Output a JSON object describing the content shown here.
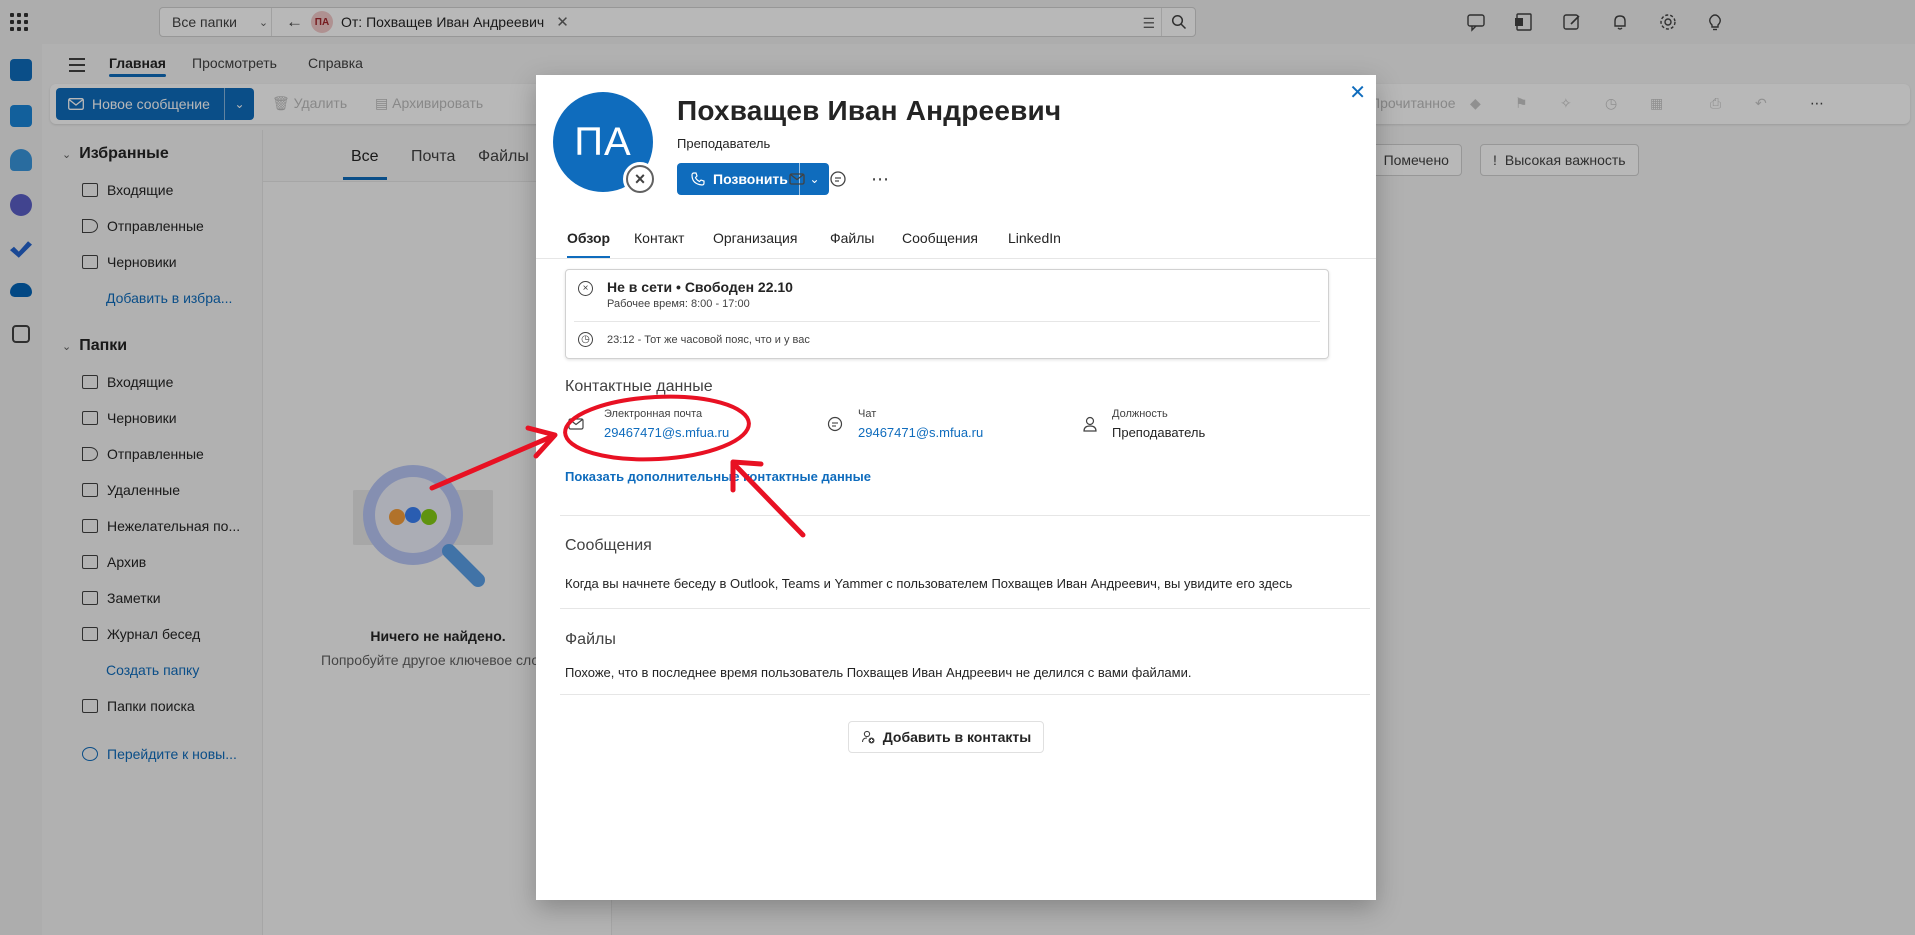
{
  "topbar": {
    "search_scope": "Все папки",
    "search_avatar_initials": "ПА",
    "search_chip": "От: Похващев Иван Андреевич",
    "icons": [
      "waffle-icon",
      "feedback-icon",
      "onenote-icon",
      "my-day-icon",
      "notifications-icon",
      "settings-icon",
      "tips-icon"
    ]
  },
  "ribbon": {
    "tabs": [
      "Главная",
      "Просмотреть",
      "Справка"
    ],
    "active_tab": "Главная",
    "new_message": "Новое сообщение",
    "commands": [
      "Удалить",
      "Архивировать",
      "Прочитанное"
    ]
  },
  "folders": {
    "favorites_header": "Избранные",
    "favorites": [
      "Входящие",
      "Отправленные",
      "Черновики"
    ],
    "add_favorite": "Добавить в избра...",
    "folders_header": "Папки",
    "items": [
      "Входящие",
      "Черновики",
      "Отправленные",
      "Удаленные",
      "Нежелательная по...",
      "Архив",
      "Заметки",
      "Журнал бесед"
    ],
    "create_folder": "Создать папку",
    "search_folders": "Папки поиска",
    "go_to_groups": "Перейдите к новы..."
  },
  "list": {
    "tabs": [
      "Все",
      "Почта",
      "Файлы"
    ],
    "empty_title": "Ничего не найдено.",
    "empty_subtitle": "Попробуйте другое ключевое сло"
  },
  "reading": {
    "flagged": "Помечено",
    "high_importance": "Высокая важность"
  },
  "card": {
    "initials": "ПА",
    "name": "Похващев Иван Андреевич",
    "job_title": "Преподаватель",
    "call_label": "Позвонить",
    "tabs": [
      "Обзор",
      "Контакт",
      "Организация",
      "Файлы",
      "Сообщения",
      "LinkedIn"
    ],
    "active_tab": "Обзор",
    "status": {
      "availability": "Не в сети • Свободен 22.10",
      "work_hours": "Рабочее время: 8:00 - 17:00",
      "local_time": "23:12 - Тот же часовой пояс, что и у вас"
    },
    "contact": {
      "heading": "Контактные данные",
      "email_label": "Электронная почта",
      "email_value": "29467471@s.mfua.ru",
      "chat_label": "Чат",
      "chat_value": "29467471@s.mfua.ru",
      "position_label": "Должность",
      "position_value": "Преподаватель",
      "show_more": "Показать дополнительные контактные данные"
    },
    "messages": {
      "heading": "Сообщения",
      "text": "Когда вы начнете беседу в Outlook, Teams и Yammer с пользователем Похващев Иван Андреевич, вы увидите его здесь"
    },
    "files": {
      "heading": "Файлы",
      "text": "Похоже, что в последнее время пользователь Похващев Иван Андреевич не делился с вами файлами."
    },
    "add_contact": "Добавить в контакты"
  },
  "colors": {
    "accent": "#0f6cbd",
    "annotation": "#e81123",
    "overlay": "rgba(0,0,0,0.28)"
  }
}
